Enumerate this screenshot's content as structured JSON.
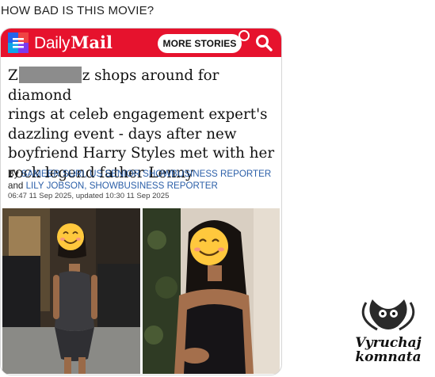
{
  "post": {
    "caption": "HOW BAD IS THIS MOVIE?"
  },
  "header": {
    "logo_daily": "Daily",
    "logo_mail": "Mail",
    "more_stories_label": "MORE STORIES",
    "menu_icon": "hamburger-menu-icon",
    "search_icon": "search-icon",
    "brand_color": "#e6122d"
  },
  "article": {
    "headline_first_letter": "Z",
    "headline_rest_line1": "z shops around for diamond",
    "headline_line2": "rings at celeb engagement expert's",
    "headline_line3": "dazzling event - days after new",
    "headline_line4": "boyfriend Harry Styles met with her",
    "headline_line5": "rock legend father Lenny",
    "byline_by": "By",
    "author1": "SAMEER SURI, US SENIOR SHOWBUSINESS REPORTER",
    "byline_and": "and",
    "author2": "LILY JOBSON, SHOWBUSINESS REPORTER",
    "timestamp": "06:47 11 Sep 2025, updated 10:30 11 Sep 2025",
    "link_color": "#2b5fa8"
  },
  "photos": {
    "left_emoji": "smiling-face-emoji",
    "right_emoji": "smiling-face-emoji"
  },
  "watermark": {
    "line1": "Vyruchaj",
    "line2": "komnata",
    "icon": "owl-icon"
  }
}
